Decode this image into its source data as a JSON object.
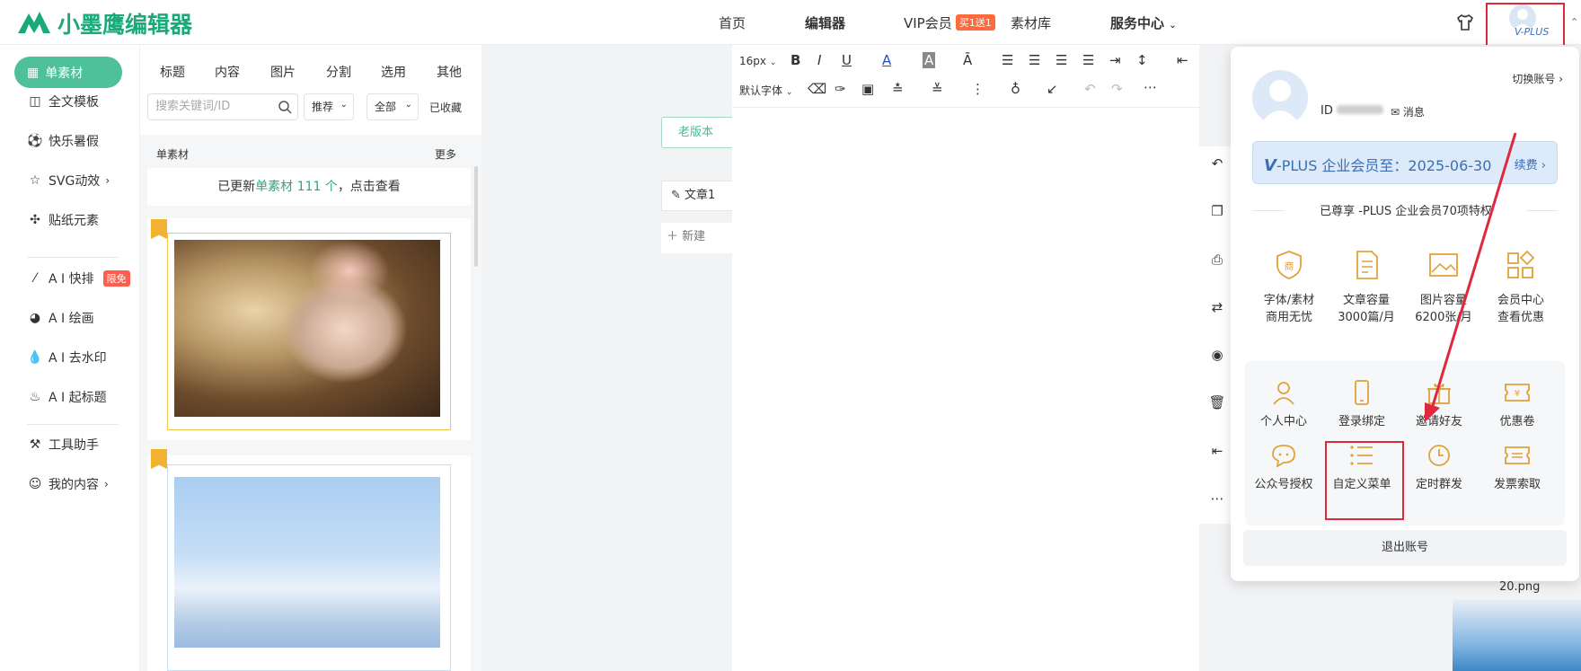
{
  "app": {
    "logo_text": "小墨鹰编辑器"
  },
  "nav": {
    "home": "首页",
    "editor": "编辑器",
    "vip": "VIP会员",
    "vip_badge": "买1送1",
    "library": "素材库",
    "service": "服务中心"
  },
  "user": {
    "vplus_tag": "V-PLUS"
  },
  "leftmenu": {
    "items": [
      {
        "label": "单素材",
        "icon": "grid-icon"
      },
      {
        "label": "全文模板",
        "icon": "template-icon"
      },
      {
        "label": "快乐暑假",
        "icon": "ball-icon"
      },
      {
        "label": "SVG动效",
        "icon": "star-icon"
      },
      {
        "label": "贴纸元素",
        "icon": "puzzle-icon"
      },
      {
        "label": "A I 快排",
        "icon": "ai-icon",
        "badge": "限免"
      },
      {
        "label": "A I 绘画",
        "icon": "palette-icon"
      },
      {
        "label": "A I 去水印",
        "icon": "drop-icon"
      },
      {
        "label": "A I 起标题",
        "icon": "flame-icon"
      },
      {
        "label": "工具助手",
        "icon": "tool-icon"
      },
      {
        "label": "我的内容",
        "icon": "user-icon"
      }
    ]
  },
  "panel": {
    "tabs": [
      "标题",
      "内容",
      "图片",
      "分割",
      "选用",
      "其他"
    ],
    "search_placeholder": "搜索关键词/ID",
    "sort_value": "推荐",
    "scope_value": "全部",
    "favorites": "已收藏",
    "section_title": "单素材",
    "more": "更多",
    "notice_pre": "已更新",
    "notice_highlight": "单素材 111 个",
    "notice_post": "，点击查看"
  },
  "canvas": {
    "old_version": "老版本",
    "doc_name": "文章1",
    "new_doc": "新建"
  },
  "toolbar": {
    "font_size": "16px",
    "font_family": "默认字体"
  },
  "thumbs": {
    "file_label": "20.png"
  },
  "popup": {
    "switch_account": "切换账号",
    "id_label": "ID",
    "message": "消息",
    "vip_text": "-PLUS 企业会员至：2025-06-30",
    "renew": "续费",
    "enjoy": "已尊享 -PLUS 企业会员70项特权",
    "perks": [
      {
        "line1": "字体/素材",
        "line2": "商用无忧",
        "icon": "shield-icon"
      },
      {
        "line1": "文章容量",
        "line2": "3000篇/月",
        "icon": "document-icon"
      },
      {
        "line1": "图片容量",
        "line2": "6200张/月",
        "icon": "image-icon"
      },
      {
        "line1": "会员中心",
        "line2": "查看优惠",
        "icon": "apps-icon"
      }
    ],
    "grid": [
      {
        "label": "个人中心",
        "icon": "person-icon"
      },
      {
        "label": "登录绑定",
        "icon": "phone-icon"
      },
      {
        "label": "邀请好友",
        "icon": "gift-icon"
      },
      {
        "label": "优惠卷",
        "icon": "coupon-icon"
      },
      {
        "label": "公众号授权",
        "icon": "chat-icon"
      },
      {
        "label": "自定义菜单",
        "icon": "list-icon"
      },
      {
        "label": "定时群发",
        "icon": "clock-icon"
      },
      {
        "label": "发票索取",
        "icon": "ticket-icon"
      }
    ],
    "logout": "退出账号"
  },
  "colors": {
    "brand": "#1aaa79",
    "accent": "#e0a23b",
    "highlight": "#e0283c"
  }
}
